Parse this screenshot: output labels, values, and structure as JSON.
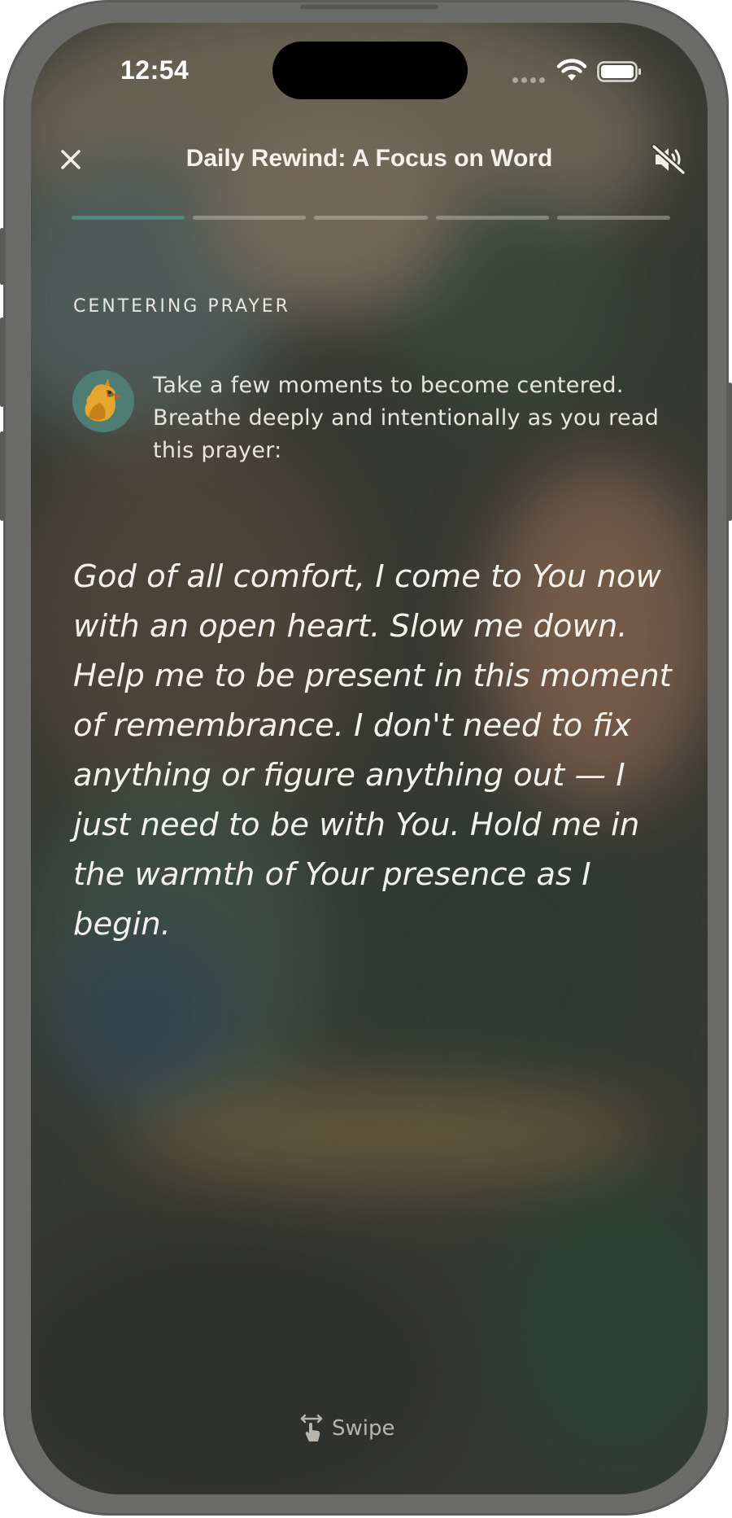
{
  "status_bar": {
    "time": "12:54",
    "icons": [
      "signal-dots-icon",
      "wifi-icon",
      "battery-icon"
    ]
  },
  "header": {
    "close_icon": "close-icon",
    "title": "Daily Rewind: A Focus on Word",
    "mute_icon": "speaker-muted-icon"
  },
  "progress": {
    "segments": 5,
    "current": 1,
    "active_color": "#4f8a7d"
  },
  "content": {
    "section_label": "CENTERING PRAYER",
    "avatar_icon": "cardinal-bird-icon",
    "intro": "Take a few moments to become centered. Breathe deeply and intentionally as you read this prayer:",
    "prayer": "God of all comfort, I come to You now with an open heart. Slow me down. Help me to be present in this moment of remembrance. I don't need to fix anything or figure anything out — I just need to be with You. Hold me in the warmth of Your presence as I begin."
  },
  "footer": {
    "swipe_icon": "swipe-hand-icon",
    "swipe_label": "Swipe"
  }
}
